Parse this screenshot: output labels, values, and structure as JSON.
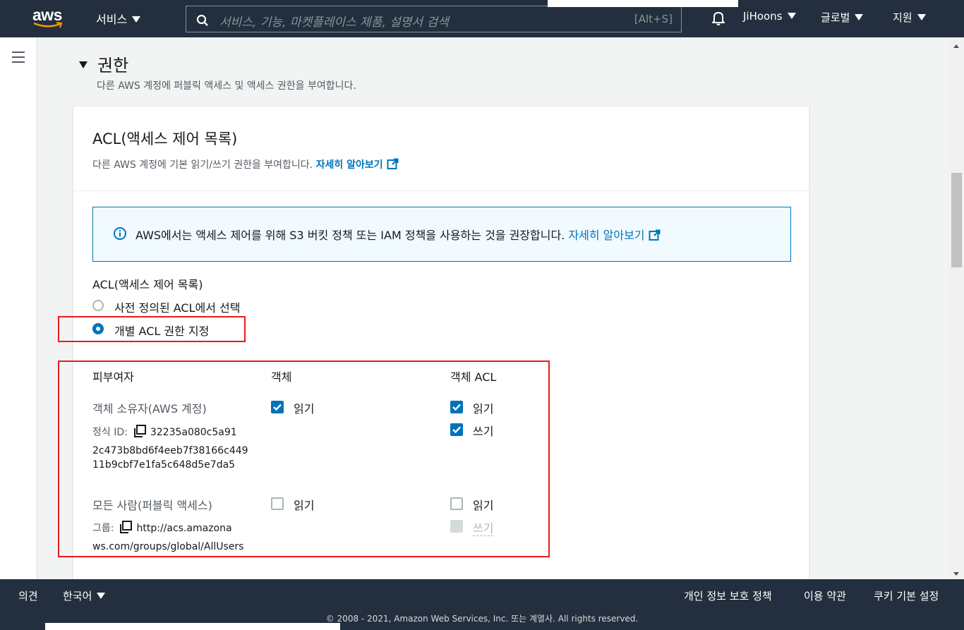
{
  "topbar": {
    "logo_text": "aws",
    "services_label": "서비스",
    "search_placeholder": "서비스, 기능, 마켓플레이스 제품, 설명서 검색",
    "search_shortcut": "[Alt+S]",
    "user": "JiHoons",
    "region": "글로벌",
    "support": "지원"
  },
  "section": {
    "title": "권한",
    "description": "다른 AWS 계정에 퍼블릭 액세스 및 액세스 권한을 부여합니다."
  },
  "panel": {
    "title": "ACL(액세스 제어 목록)",
    "description": "다른 AWS 계정에 기본 읽기/쓰기 권한을 부여합니다.",
    "learn_more": "자세히 알아보기",
    "alert_text": "AWS에서는 액세스 제어를 위해 S3 버킷 정책 또는 IAM 정책을 사용하는 것을 권장합니다.",
    "alert_link": "자세히 알아보기",
    "acl_label": "ACL(액세스 제어 목록)",
    "radio_predefined": "사전 정의된 ACL에서 선택",
    "radio_individual": "개별 ACL 권한 지정"
  },
  "grants": {
    "headers": {
      "grantee": "피부여자",
      "object": "객체",
      "object_acl": "객체 ACL"
    },
    "owner": {
      "name": "객체 소유자(AWS 계정)",
      "id_label": "정식 ID:",
      "id_line1": "32235a080c5a91",
      "id_line2": "2c473b8bd6f4eeb7f38166c449",
      "id_line3": "11b9cbf7e1fa5c648d5e7da5",
      "object_read": "읽기",
      "acl_read": "읽기",
      "acl_write": "쓰기"
    },
    "everyone": {
      "name": "모든 사람(퍼블릭 액세스)",
      "group_label": "그룹:",
      "group_line1": "http://acs.amazona",
      "group_line2": "ws.com/groups/global/AllUsers",
      "object_read": "읽기",
      "acl_read": "읽기",
      "acl_write": "쓰기"
    }
  },
  "footer": {
    "feedback": "의견",
    "language": "한국어",
    "privacy": "개인 정보 보호 정책",
    "terms": "이용 약관",
    "cookies": "쿠키 기본 설정",
    "copyright": "© 2008 - 2021, Amazon Web Services, Inc. 또는 계열사. All rights reserved."
  },
  "colors": {
    "nav": "#232f3e",
    "accent": "#0073bb",
    "highlight": "#e81b1b",
    "orange": "#ff9900"
  }
}
